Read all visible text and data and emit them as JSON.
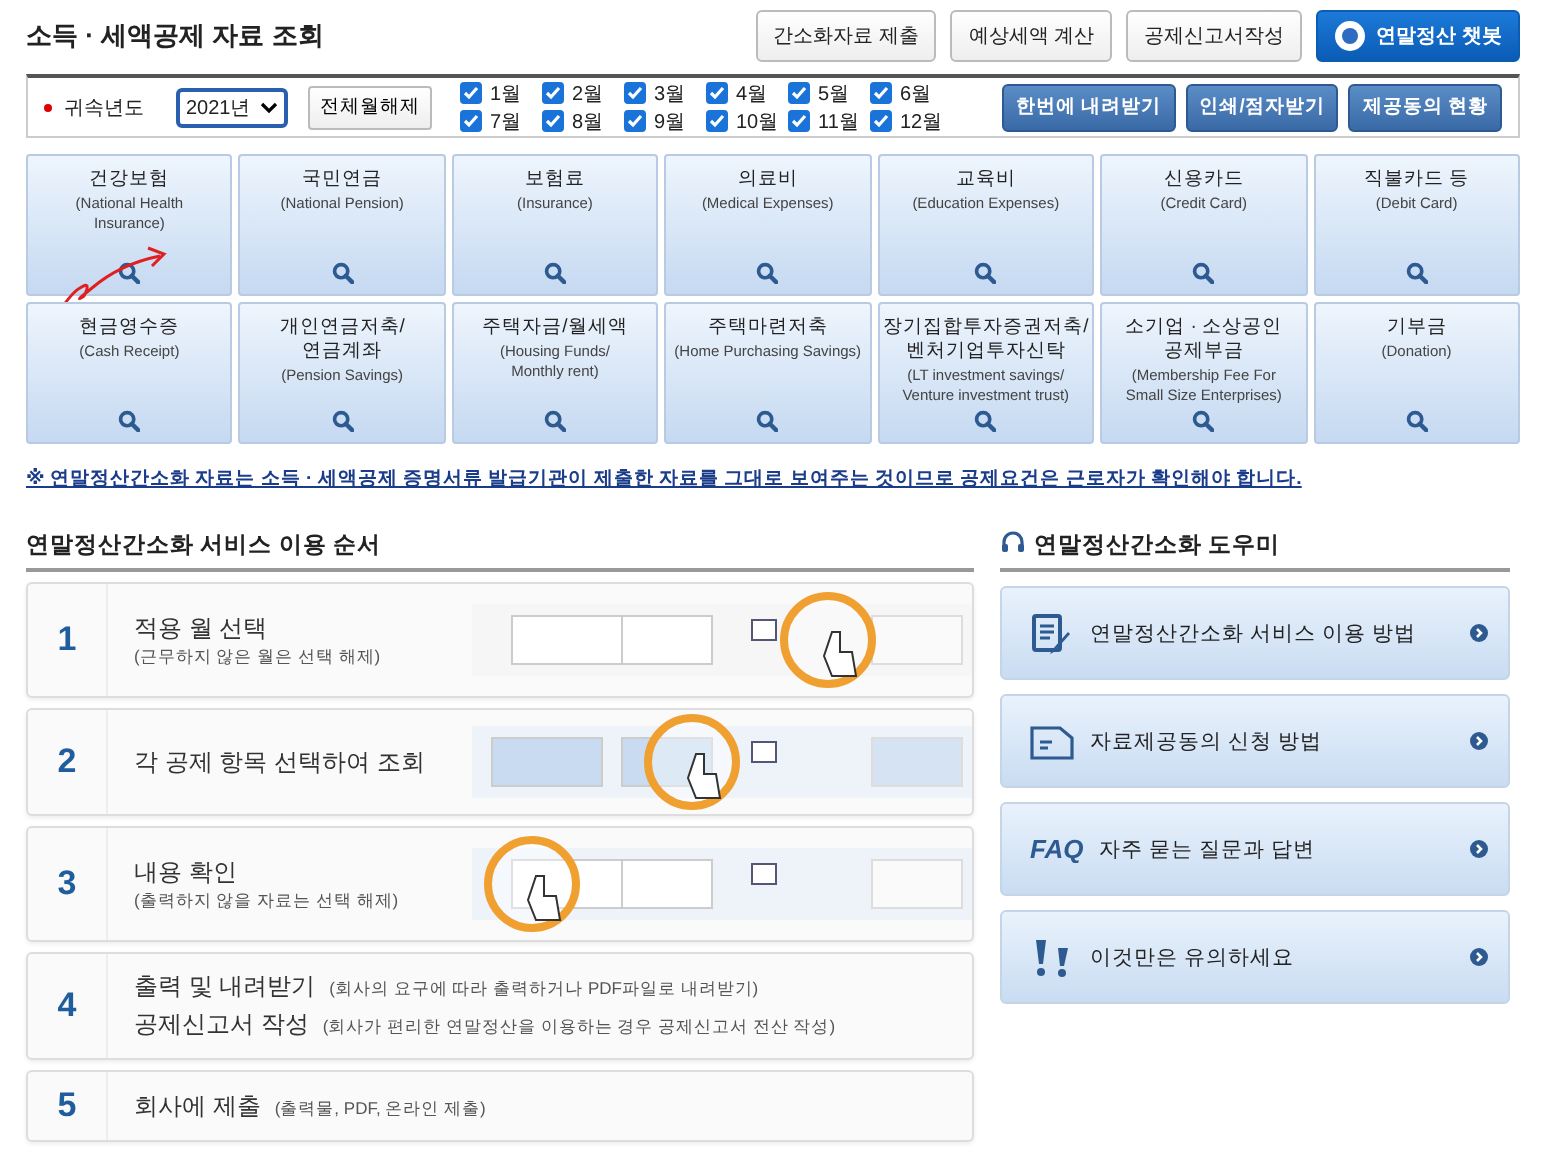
{
  "title": "소득 · 세액공제 자료 조회",
  "header_buttons": [
    {
      "label": "간소화자료 제출",
      "kind": "plain"
    },
    {
      "label": "예상세액 계산",
      "kind": "plain"
    },
    {
      "label": "공제신고서작성",
      "kind": "plain"
    },
    {
      "label": "연말정산 챗봇",
      "kind": "chatbot"
    }
  ],
  "filter": {
    "required": true,
    "label": "귀속년도",
    "year": "2021년",
    "clear_button": "전체월해제",
    "months": [
      {
        "label": "1월",
        "checked": true
      },
      {
        "label": "2월",
        "checked": true
      },
      {
        "label": "3월",
        "checked": true
      },
      {
        "label": "4월",
        "checked": true
      },
      {
        "label": "5월",
        "checked": true
      },
      {
        "label": "6월",
        "checked": true
      },
      {
        "label": "7월",
        "checked": true
      },
      {
        "label": "8월",
        "checked": true
      },
      {
        "label": "9월",
        "checked": true
      },
      {
        "label": "10월",
        "checked": true
      },
      {
        "label": "11월",
        "checked": true
      },
      {
        "label": "12월",
        "checked": true
      }
    ],
    "actions": [
      "한번에 내려받기",
      "인쇄/점자받기",
      "제공동의 현황"
    ]
  },
  "categories": [
    {
      "name_lines": [
        "건강보험"
      ],
      "english_lines": [
        "(National Health",
        "Insurance)"
      ],
      "annotated": true
    },
    {
      "name_lines": [
        "국민연금"
      ],
      "english_lines": [
        "(National Pension)"
      ],
      "annotated": false
    },
    {
      "name_lines": [
        "보험료"
      ],
      "english_lines": [
        "(Insurance)"
      ],
      "annotated": false
    },
    {
      "name_lines": [
        "의료비"
      ],
      "english_lines": [
        "(Medical Expenses)"
      ],
      "annotated": false
    },
    {
      "name_lines": [
        "교육비"
      ],
      "english_lines": [
        "(Education Expenses)"
      ],
      "annotated": false
    },
    {
      "name_lines": [
        "신용카드"
      ],
      "english_lines": [
        "(Credit Card)"
      ],
      "annotated": false
    },
    {
      "name_lines": [
        "직불카드 등"
      ],
      "english_lines": [
        "(Debit Card)"
      ],
      "annotated": false
    },
    {
      "name_lines": [
        "현금영수증"
      ],
      "english_lines": [
        "(Cash Receipt)"
      ],
      "annotated": false
    },
    {
      "name_lines": [
        "개인연금저축/",
        "연금계좌"
      ],
      "english_lines": [
        "(Pension Savings)"
      ],
      "annotated": false
    },
    {
      "name_lines": [
        "주택자금/월세액"
      ],
      "english_lines": [
        "(Housing Funds/",
        "Monthly rent)"
      ],
      "annotated": false
    },
    {
      "name_lines": [
        "주택마련저축"
      ],
      "english_lines": [
        "(Home Purchasing Savings)"
      ],
      "annotated": false
    },
    {
      "name_lines": [
        "장기집합투자증권저축/",
        "벤처기업투자신탁"
      ],
      "english_lines": [
        "(LT investment savings/",
        "Venture investment trust)"
      ],
      "annotated": false
    },
    {
      "name_lines": [
        "소기업 · 소상공인",
        "공제부금"
      ],
      "english_lines": [
        "(Membership Fee For",
        "Small Size Enterprises)"
      ],
      "annotated": false
    },
    {
      "name_lines": [
        "기부금"
      ],
      "english_lines": [
        "(Donation)"
      ],
      "annotated": false
    }
  ],
  "notice": "※ 연말정산간소화 자료는 소득 · 세액공제 증명서류 발급기관이 제출한 자료를 그대로 보여주는 것이므로 공제요건은 근로자가 확인해야 합니다.",
  "steps_title": "연말정산간소화 서비스 이용 순서",
  "steps": [
    {
      "number": "1",
      "kind": "stacked",
      "lines": [
        {
          "title": "적용 월 선택",
          "note": "(근무하지 않은 월은 선택 해제)"
        }
      ],
      "picture": true
    },
    {
      "number": "2",
      "kind": "stacked",
      "lines": [
        {
          "title": "각 공제 항목 선택하여 조회"
        }
      ],
      "picture": true
    },
    {
      "number": "3",
      "kind": "stacked",
      "lines": [
        {
          "title": "내용 확인",
          "note": "(출력하지 않을 자료는 선택 해제)"
        }
      ],
      "picture": true
    },
    {
      "number": "4",
      "kind": "inline",
      "lines": [
        {
          "title": "출력 및 내려받기",
          "note": "(회사의 요구에 따라 출력하거나 PDF파일로 내려받기)"
        },
        {
          "title": "공제신고서 작성",
          "note": "(회사가 편리한 연말정산을 이용하는 경우 공제신고서 전산 작성)"
        }
      ],
      "picture": false
    },
    {
      "number": "5",
      "kind": "inline",
      "lines": [
        {
          "title": "회사에 제출",
          "note": "(출력물, PDF, 온라인 제출)"
        }
      ],
      "picture": false
    }
  ],
  "help_title": "연말정산간소화 도우미",
  "help_items": [
    {
      "kind": "document",
      "label": "연말정산간소화 서비스 이용 방법"
    },
    {
      "kind": "form",
      "label": "자료제공동의 신청 방법"
    },
    {
      "kind": "faq",
      "badge": "FAQ",
      "label": "자주 묻는 질문과 답변"
    },
    {
      "kind": "alert",
      "label": "이것만은 유의하세요"
    }
  ]
}
